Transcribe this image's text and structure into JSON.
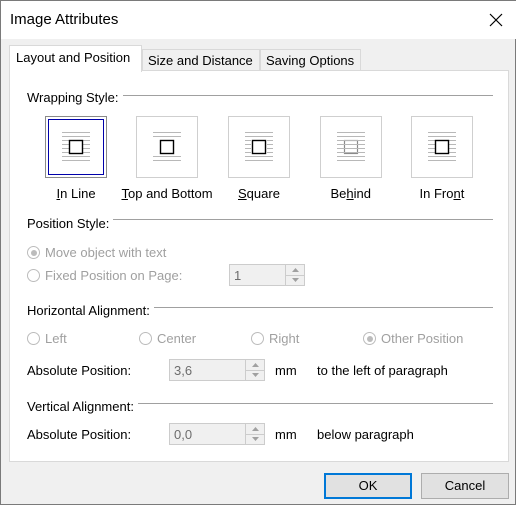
{
  "window": {
    "title": "Image Attributes"
  },
  "tabs": [
    {
      "label": "Layout and Position",
      "active": true
    },
    {
      "label": "Size and Distance",
      "active": false
    },
    {
      "label": "Saving Options",
      "active": false
    }
  ],
  "wrapping": {
    "label": "Wrapping Style:",
    "options": [
      {
        "pre": "",
        "key": "I",
        "post": "n Line",
        "selected": true
      },
      {
        "pre": "",
        "key": "T",
        "post": "op and Bottom",
        "selected": false
      },
      {
        "pre": "",
        "key": "S",
        "post": "quare",
        "selected": false
      },
      {
        "pre": "Be",
        "key": "h",
        "post": "ind",
        "selected": false
      },
      {
        "pre": "In Fro",
        "key": "n",
        "post": "t",
        "selected": false
      }
    ]
  },
  "position_style": {
    "label": "Position Style:",
    "move_with_text": "Move object with text",
    "fixed_position": "Fixed Position on Page:",
    "page_value": "1"
  },
  "horizontal": {
    "label": "Horizontal Alignment:",
    "options": [
      "Left",
      "Center",
      "Right",
      "Other Position"
    ],
    "selected": "Other Position",
    "abs_label": "Absolute Position:",
    "abs_value": "3,6",
    "unit": "mm",
    "relation": "to the left of paragraph"
  },
  "vertical": {
    "label": "Vertical Alignment:",
    "abs_label": "Absolute Position:",
    "abs_value": "0,0",
    "unit": "mm",
    "relation": "below paragraph"
  },
  "buttons": {
    "ok": "OK",
    "cancel": "Cancel"
  },
  "colors": {
    "selection_border": "#0000aa",
    "default_button_border": "#0078d7",
    "disabled_text": "#a0a0a0"
  },
  "icons": {
    "close": "close-icon",
    "spin_up": "chevron-up-icon",
    "spin_down": "chevron-down-icon"
  }
}
